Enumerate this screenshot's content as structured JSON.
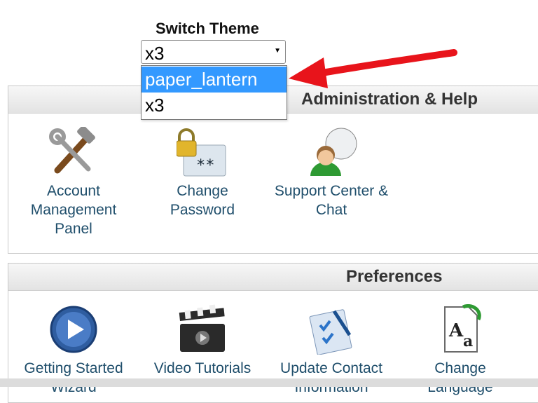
{
  "switch_theme": {
    "label": "Switch Theme",
    "selected_value": "x3",
    "options": [
      "paper_lantern",
      "x3"
    ]
  },
  "sections": [
    {
      "title": "Administration & Help",
      "items": [
        {
          "label": "Account Management Panel",
          "icon": "tools-icon"
        },
        {
          "label": "Change Password",
          "icon": "lock-password-icon"
        },
        {
          "label": "Support Center & Chat",
          "icon": "support-chat-icon"
        }
      ]
    },
    {
      "title": "Preferences",
      "items": [
        {
          "label": "Getting Started Wizard",
          "icon": "play-icon"
        },
        {
          "label": "Video Tutorials",
          "icon": "clapperboard-icon"
        },
        {
          "label": "Update Contact Information",
          "icon": "contact-checklist-icon"
        },
        {
          "label": "Change Language",
          "icon": "language-icon"
        }
      ]
    }
  ],
  "colors": {
    "highlight": "#3399ff",
    "link": "#1f4e6b",
    "arrow": "#e8141b"
  }
}
